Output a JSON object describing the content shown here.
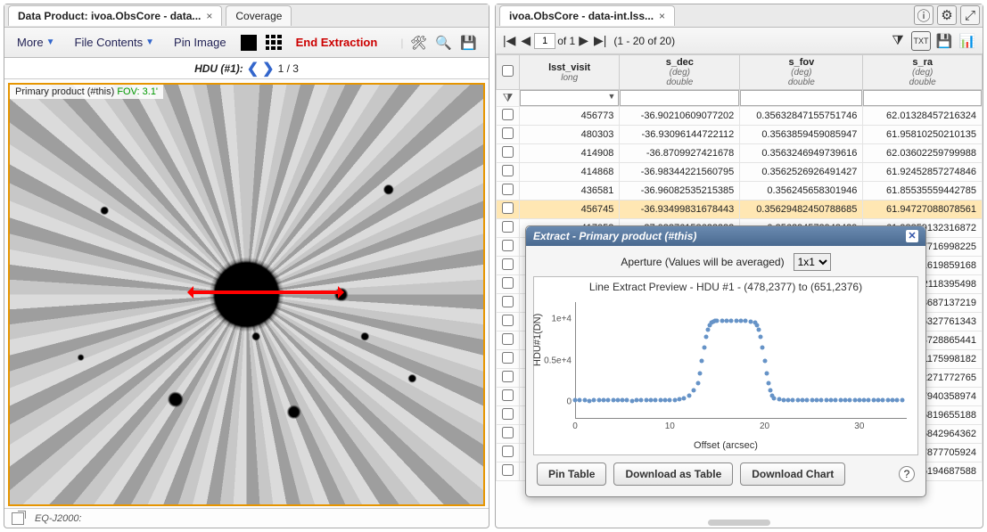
{
  "left": {
    "tab_label": "Data Product: ivoa.ObsCore - data...",
    "tab2": "Coverage",
    "toolbar": {
      "more": "More",
      "file_contents": "File Contents",
      "pin_image": "Pin Image",
      "end_extraction": "End Extraction"
    },
    "hdu": {
      "label": "HDU (#1):",
      "pos": "1 / 3"
    },
    "info": {
      "text": "Primary product (#this)",
      "fov": "FOV: 3.1'"
    },
    "footer": {
      "coord": "EQ-J2000:"
    }
  },
  "right": {
    "tab_label": "ivoa.ObsCore - data-int.lss...",
    "pager": {
      "page": "1",
      "of": "of 1",
      "range": "(1 - 20 of 20)"
    },
    "columns": [
      {
        "name": "lsst_visit",
        "unit": "",
        "type": "long"
      },
      {
        "name": "s_dec",
        "unit": "(deg)",
        "type": "double"
      },
      {
        "name": "s_fov",
        "unit": "(deg)",
        "type": "double"
      },
      {
        "name": "s_ra",
        "unit": "(deg)",
        "type": "double"
      }
    ],
    "rows": [
      {
        "v": "456773",
        "d": "-36.90210609077202",
        "f": "0.35632847155751746",
        "r": "62.01328457216324"
      },
      {
        "v": "480303",
        "d": "-36.93096144722112",
        "f": "0.3563859459085947",
        "r": "61.95810250210135"
      },
      {
        "v": "414908",
        "d": "-36.8709927421678",
        "f": "0.3563246949739616",
        "r": "62.03602259799988"
      },
      {
        "v": "414868",
        "d": "-36.98344221560795",
        "f": "0.3562526926491427",
        "r": "61.92452857274846"
      },
      {
        "v": "436581",
        "d": "-36.96082535215385",
        "f": "0.356245658301946",
        "r": "61.85535559442785"
      },
      {
        "v": "456745",
        "d": "-36.93499831678443",
        "f": "0.35629482450788685",
        "r": "61.94727088078561",
        "sel": true
      },
      {
        "v": "417052",
        "d": "-37.03876158622222",
        "f": "0.356294572943429",
        "r": "61.98859132316872"
      },
      {
        "v": "",
        "d": "",
        "f": "",
        "r": "7716998225"
      },
      {
        "v": "",
        "d": "",
        "f": "",
        "r": "1619859168"
      },
      {
        "v": "",
        "d": "",
        "f": "",
        "r": "2118395498"
      },
      {
        "v": "",
        "d": "",
        "f": "",
        "r": "3687137219"
      },
      {
        "v": "",
        "d": "",
        "f": "",
        "r": "5327761343"
      },
      {
        "v": "",
        "d": "",
        "f": "",
        "r": "4728865441"
      },
      {
        "v": "",
        "d": "",
        "f": "",
        "r": "1175998182"
      },
      {
        "v": "",
        "d": "",
        "f": "",
        "r": "2271772765"
      },
      {
        "v": "",
        "d": "",
        "f": "",
        "r": "7940358974"
      },
      {
        "v": "",
        "d": "",
        "f": "",
        "r": "5819655188"
      },
      {
        "v": "",
        "d": "",
        "f": "",
        "r": "5842964362"
      },
      {
        "v": "",
        "d": "",
        "f": "",
        "r": "7877705924"
      },
      {
        "v": "",
        "d": "",
        "f": "",
        "r": "5194687588"
      }
    ]
  },
  "popup": {
    "title": "Extract - Primary product (#this)",
    "aperture_label": "Aperture (Values will be averaged)",
    "aperture_value": "1x1",
    "pin_table": "Pin Table",
    "download_table": "Download as Table",
    "download_chart": "Download Chart"
  },
  "chart_data": {
    "type": "scatter",
    "title": "Line Extract Preview -  HDU #1 - (478,2377) to (651,2376)",
    "xlabel": "Offset (arcsec)",
    "ylabel": "HDU#1(DN)",
    "xlim": [
      0,
      35
    ],
    "ylim": [
      -2000,
      12000
    ],
    "xticks": [
      0,
      10,
      20,
      30
    ],
    "yticks": [
      {
        "v": 0,
        "label": "0"
      },
      {
        "v": 5000,
        "label": "0.5e+4"
      },
      {
        "v": 10000,
        "label": "1e+4"
      }
    ],
    "series": [
      {
        "name": "profile",
        "x": [
          0,
          0.5,
          1,
          1.5,
          2,
          2.5,
          3,
          3.5,
          4,
          4.5,
          5,
          5.5,
          6,
          6.5,
          7,
          7.5,
          8,
          8.5,
          9,
          9.5,
          10,
          10.5,
          11,
          11.5,
          12,
          12.5,
          13,
          13.2,
          13.4,
          13.6,
          13.8,
          14,
          14.2,
          14.4,
          14.6,
          14.8,
          15,
          15.5,
          16,
          16.5,
          17,
          17.5,
          18,
          18.5,
          19,
          19.2,
          19.4,
          19.6,
          19.8,
          20,
          20.2,
          20.4,
          20.6,
          20.8,
          21,
          21.5,
          22,
          22.5,
          23,
          23.5,
          24,
          24.5,
          25,
          25.5,
          26,
          26.5,
          27,
          27.5,
          28,
          28.5,
          29,
          29.5,
          30,
          30.5,
          31,
          31.5,
          32,
          32.5,
          33,
          33.5,
          34,
          34.5
        ],
        "y": [
          200,
          210,
          200,
          190,
          210,
          200,
          205,
          195,
          200,
          200,
          210,
          200,
          190,
          200,
          210,
          205,
          200,
          200,
          210,
          200,
          220,
          260,
          350,
          500,
          800,
          1400,
          2300,
          3500,
          5000,
          6500,
          7800,
          8700,
          9200,
          9500,
          9700,
          9800,
          9800,
          9800,
          9800,
          9800,
          9800,
          9800,
          9800,
          9700,
          9500,
          9200,
          8700,
          7800,
          6500,
          5000,
          3500,
          2300,
          1400,
          800,
          500,
          350,
          260,
          220,
          210,
          200,
          200,
          210,
          200,
          205,
          200,
          195,
          200,
          210,
          200,
          200,
          205,
          200,
          200,
          200,
          200,
          200,
          205,
          200,
          200,
          200,
          200,
          200
        ]
      }
    ]
  }
}
